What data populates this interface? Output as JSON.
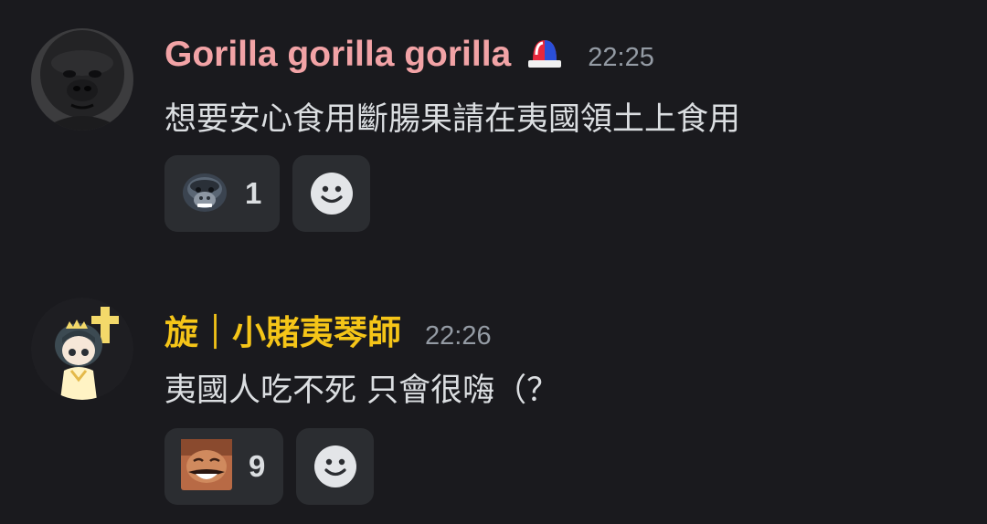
{
  "messages": [
    {
      "username": "Gorilla gorilla gorilla",
      "username_color": "#f2a3a6",
      "role_icon": "siren-icon",
      "timestamp": "22:25",
      "content": "想要安心食用斷腸果請在夷國領土上食用",
      "reactions": [
        {
          "emoji": "gorilla-emoji",
          "count": "1"
        }
      ],
      "add_reaction_icon": "smile-icon"
    },
    {
      "username": "旋｜小賭夷琴師",
      "username_color": "#f5c518",
      "timestamp": "22:26",
      "content": "夷國人吃不死 只會很嗨（？",
      "reactions": [
        {
          "emoji": "laughing-man-emoji",
          "count": "9"
        }
      ],
      "add_reaction_icon": "smile-icon"
    }
  ]
}
